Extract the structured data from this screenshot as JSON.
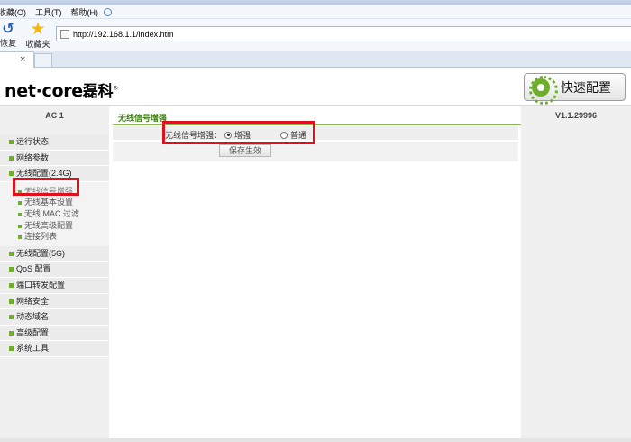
{
  "browser": {
    "menu": [
      "收藏(O)",
      "工具(T)",
      "帮助(H)"
    ],
    "toolbar": {
      "restore_label": "恢复",
      "favorites_label": "收藏夹"
    },
    "address": "http://192.168.1.1/index.htm",
    "tab_close": "×"
  },
  "header": {
    "logo_en": "net·core",
    "logo_cn": "磊科",
    "logo_mark": "®",
    "quick_config": "快速配置"
  },
  "sidebar": {
    "model": "AC 1",
    "items": [
      {
        "label": "运行状态"
      },
      {
        "label": "网络参数"
      },
      {
        "label": "无线配置(2.4G)"
      },
      {
        "label": "无线信号增强",
        "sub": true,
        "active": true
      },
      {
        "label": "无线基本设置",
        "sub": true
      },
      {
        "label": "无线 MAC 过滤",
        "sub": true
      },
      {
        "label": "无线高级配置",
        "sub": true
      },
      {
        "label": "连接列表",
        "sub": true
      },
      {
        "label": "无线配置(5G)"
      },
      {
        "label": "QoS 配置"
      },
      {
        "label": "端口转发配置"
      },
      {
        "label": "网络安全"
      },
      {
        "label": "动态域名"
      },
      {
        "label": "高级配置"
      },
      {
        "label": "系统工具"
      }
    ]
  },
  "content": {
    "section_title": "无线信号增强",
    "field_label": "无线信号增强：",
    "options": [
      {
        "label": "增强",
        "selected": true
      },
      {
        "label": "普通",
        "selected": false
      }
    ],
    "save_button": "保存生效"
  },
  "rightpane": {
    "version": "V1.1.29996"
  },
  "colors": {
    "accent_green": "#6fae2d",
    "highlight_red": "#e0111d"
  }
}
